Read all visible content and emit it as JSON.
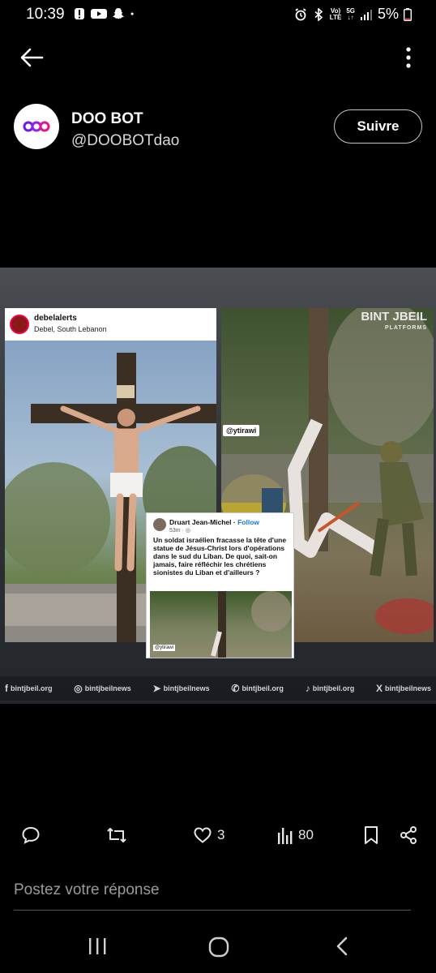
{
  "status_bar": {
    "time": "10:39",
    "battery": "5%",
    "net_top": "Vo)",
    "net_bottom": "LTE",
    "gen": "5G"
  },
  "profile": {
    "name": "DOO BOT",
    "handle": "@DOOBOTdao",
    "follow_label": "Suivre"
  },
  "media": {
    "ig_user": "debelalerts",
    "ig_location": "Debel, South Lebanon",
    "tag": "@ytirawi",
    "watermark_top": "BINT JBEIL",
    "watermark_bottom": "PLATFORMS",
    "fb_author": "Druart Jean-Michel",
    "fb_follow": "Follow",
    "fb_time": "53m",
    "fb_text": "Un soldat israélien fracasse la tête d'une statue de Jésus-Christ lors d'opérations dans le sud du Liban. De quoi, sait-on jamais, faire réfléchir les chrétiens sionistes du Liban et d'ailleurs ?",
    "fb_tag": "@ytirawi",
    "social": [
      {
        "glyph": "f",
        "label": "bintjbeil.org"
      },
      {
        "glyph": "◎",
        "label": "bintjbeilnews"
      },
      {
        "glyph": "➤",
        "label": "bintjbeilnews"
      },
      {
        "glyph": "✆",
        "label": "bintjbeil.org"
      },
      {
        "glyph": "♪",
        "label": "bintjbeil.org"
      },
      {
        "glyph": "X",
        "label": "bintjbeilnews"
      }
    ]
  },
  "actions": {
    "likes": "3",
    "views": "80"
  },
  "reply": {
    "placeholder": "Postez votre réponse"
  },
  "colors": {
    "logo_accent": "#6a1cf0",
    "logo_pink": "#e3148c",
    "fb_blue": "#1877f2"
  }
}
